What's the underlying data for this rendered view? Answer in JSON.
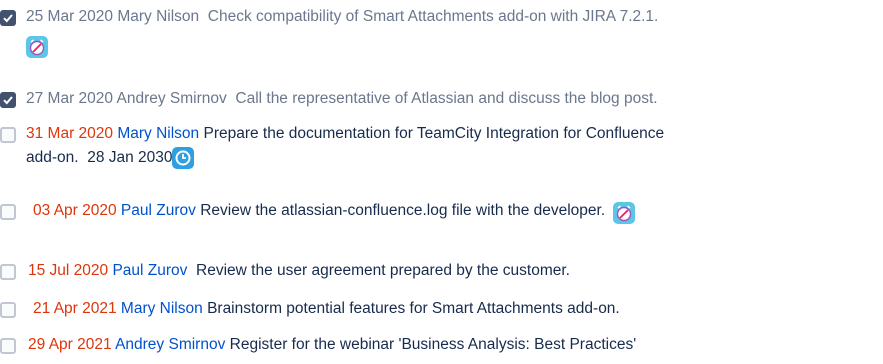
{
  "tasks": [
    {
      "completed": true,
      "date": "25 Mar 2020",
      "assignee": "Mary Nilson",
      "text": "Check compatibility of Smart Attachments add-on with JIRA 7.2.1.",
      "reminder_icon": "alarm-clock-icon"
    },
    {
      "completed": true,
      "date": "27 Mar 2020",
      "assignee": "Andrey Smirnov",
      "text": "Call the representative of Atlassian and discuss the blog post."
    },
    {
      "completed": false,
      "date": "31 Mar 2020",
      "assignee": "Mary Nilson",
      "text": "Prepare the documentation for TeamCity Integration for Confluence",
      "text_cont": "add-on.",
      "due": "28 Jan 2030",
      "reminder_icon": "clock-icon"
    },
    {
      "completed": false,
      "date": "03 Apr 2020",
      "assignee": "Paul Zurov",
      "text": "Review the atlassian-confluence.log file with the developer.",
      "reminder_icon": "alarm-clock-icon"
    },
    {
      "completed": false,
      "date": "15 Jul 2020",
      "assignee": "Paul Zurov",
      "text": "Review the user agreement prepared by the customer."
    },
    {
      "completed": false,
      "date": "21 Apr 2021",
      "assignee": "Mary Nilson",
      "text": "Brainstorm potential features for Smart Attachments add-on."
    },
    {
      "completed": false,
      "date": "29 Apr 2021",
      "assignee": "Andrey Smirnov",
      "text": "Register for the webinar 'Business Analysis: Best Practices'"
    }
  ],
  "colors": {
    "date_overdue": "#de350b",
    "mention": "#0052cc",
    "completed_text": "#6b778c",
    "checkbox_checked": "#42526e"
  }
}
